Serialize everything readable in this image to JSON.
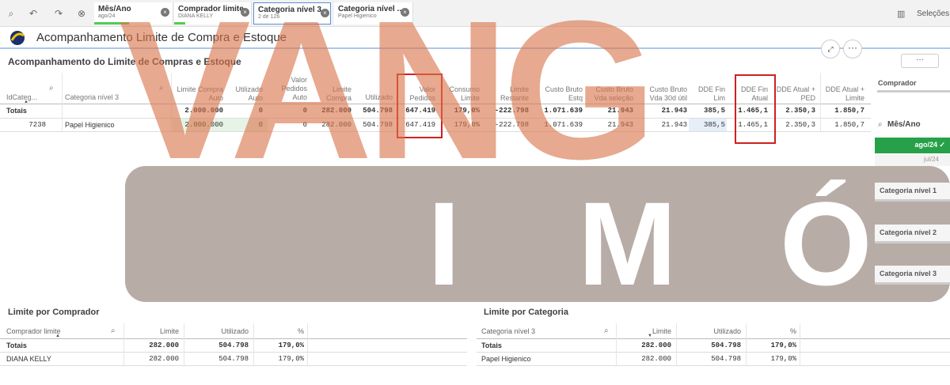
{
  "selections_bar": {
    "chips": [
      {
        "title": "Mês/Ano",
        "value": "ago/24"
      },
      {
        "title": "Comprador limite",
        "value": "DIANA KELLY"
      },
      {
        "title": "Categoria nível 3",
        "value": "2 de 126"
      },
      {
        "title": "Categoria nível ...",
        "value": "Papel Higienico"
      }
    ],
    "selections_label": "Seleções"
  },
  "app": {
    "title": "Acompanhamento Limite de Compra e Estoque"
  },
  "main_table": {
    "title": "Acompanhamento do Limite de Compras e Estoque",
    "headers": [
      "IdCateg...",
      "Categoria nível 3",
      "Limite Compra Auto",
      "Utilizado Auto",
      "Valor Pedidos Auto",
      "Limite Compra",
      "Utilizado",
      "Valor Pedidos",
      "Consumo Limite",
      "Limite Restante",
      "Custo Bruto Estq",
      "Custo Bruto Vda seleção",
      "Custo Bruto Vda 30d útil",
      "DDE Fin Lim",
      "DDE Fin Atual",
      "DDE Atual + PED",
      "DDE Atual + Limite"
    ],
    "totals": [
      "Totais",
      "",
      "2.000.000",
      "0",
      "0",
      "282.000",
      "504.798",
      "647.419",
      "179,0%",
      "-222.798",
      "1.071.639",
      "21.943",
      "21.943",
      "385,5",
      "1.465,1",
      "2.350,3",
      "1.850,7"
    ],
    "rows": [
      [
        "7238",
        "Papel Higienico",
        "2.000.000",
        "0",
        "0",
        "282.000",
        "504.798",
        "647.419",
        "179,0%",
        "-222.798",
        "1.071.639",
        "21.943",
        "21.943",
        "385,5",
        "1.465,1",
        "2.350,3",
        "1.850,7"
      ]
    ]
  },
  "watermark": {
    "top": "VANG",
    "letters": [
      "I",
      "M",
      "Ó"
    ]
  },
  "right_panel": {
    "comprador": "Comprador",
    "mes_ano": "Mês/Ano",
    "mes_selected": "ago/24 ✓",
    "mes_other": "jul/24",
    "cat1": "Categoria nível 1",
    "cat2": "Categoria nível 2",
    "cat3": "Categoria nível 3"
  },
  "comprador_table": {
    "title": "Limite por Comprador",
    "headers": [
      "Comprador limite",
      "Limite",
      "Utilizado",
      "%"
    ],
    "totals": [
      "Totais",
      "282.000",
      "504.798",
      "179,0%"
    ],
    "rows": [
      [
        "DIANA KELLY",
        "282.000",
        "504.798",
        "179,0%"
      ]
    ]
  },
  "categoria_table": {
    "title": "Limite por Categoria",
    "headers": [
      "Categoria nível 3",
      "Limite",
      "Utilizado",
      "%"
    ],
    "totals": [
      "Totais",
      "282.000",
      "504.798",
      "179,0%"
    ],
    "rows": [
      [
        "Papel Higienico",
        "282.000",
        "504.798",
        "179,0%"
      ]
    ]
  },
  "colors": {
    "accent_green": "#26a14a",
    "highlight_red": "#d02020",
    "watermark_orange": "#d8744a",
    "watermark_band": "#96847e"
  }
}
